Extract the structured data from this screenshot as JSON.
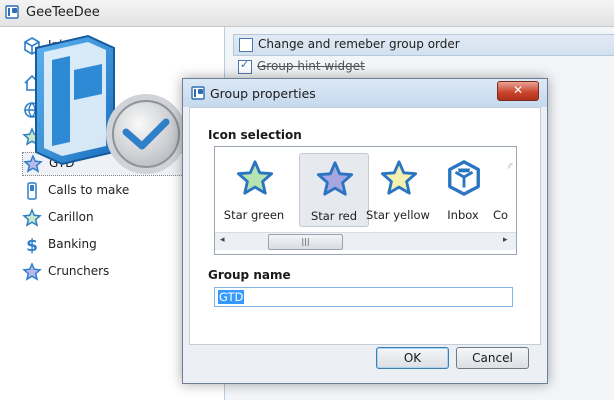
{
  "app": {
    "title": "GeeTeeDee"
  },
  "sidebar": {
    "items": [
      {
        "label": "Inbox",
        "icon": "inbox-cube-icon"
      },
      {
        "label": "",
        "icon": "home-icon"
      },
      {
        "label": "",
        "icon": "globe-icon"
      },
      {
        "label": "",
        "icon": "star-icon"
      },
      {
        "label": "GTD",
        "icon": "star-red-icon"
      },
      {
        "label": "Calls to make",
        "icon": "phone-icon"
      },
      {
        "label": "Carillon",
        "icon": "star-icon"
      },
      {
        "label": "Banking",
        "icon": "dollar-icon"
      },
      {
        "label": "Crunchers",
        "icon": "star-red-icon"
      }
    ]
  },
  "options": {
    "items": [
      {
        "label": "Change and remeber group order",
        "checked": false
      },
      {
        "label": "Group hint widget",
        "checked": true
      }
    ]
  },
  "dialog": {
    "title": "Group properties",
    "close_label": "✕",
    "icon_selection_label": "Icon selection",
    "icons": [
      {
        "label": "Star green",
        "icon": "star-green-icon"
      },
      {
        "label": "Star red",
        "icon": "star-red-icon"
      },
      {
        "label": "Star yellow",
        "icon": "star-yellow-icon"
      },
      {
        "label": "Inbox",
        "icon": "inbox-icon"
      },
      {
        "label": "Co",
        "icon": "partial-icon"
      }
    ],
    "scroll_thumb": "|||",
    "group_name_label": "Group name",
    "group_name_value": "GTD",
    "ok_label": "OK",
    "cancel_label": "Cancel"
  },
  "colors": {
    "accent_blue": "#2f7fc9",
    "star_green": "#b6e3b0",
    "star_red": "#a7a6e1",
    "star_yellow": "#f3f0b0"
  }
}
